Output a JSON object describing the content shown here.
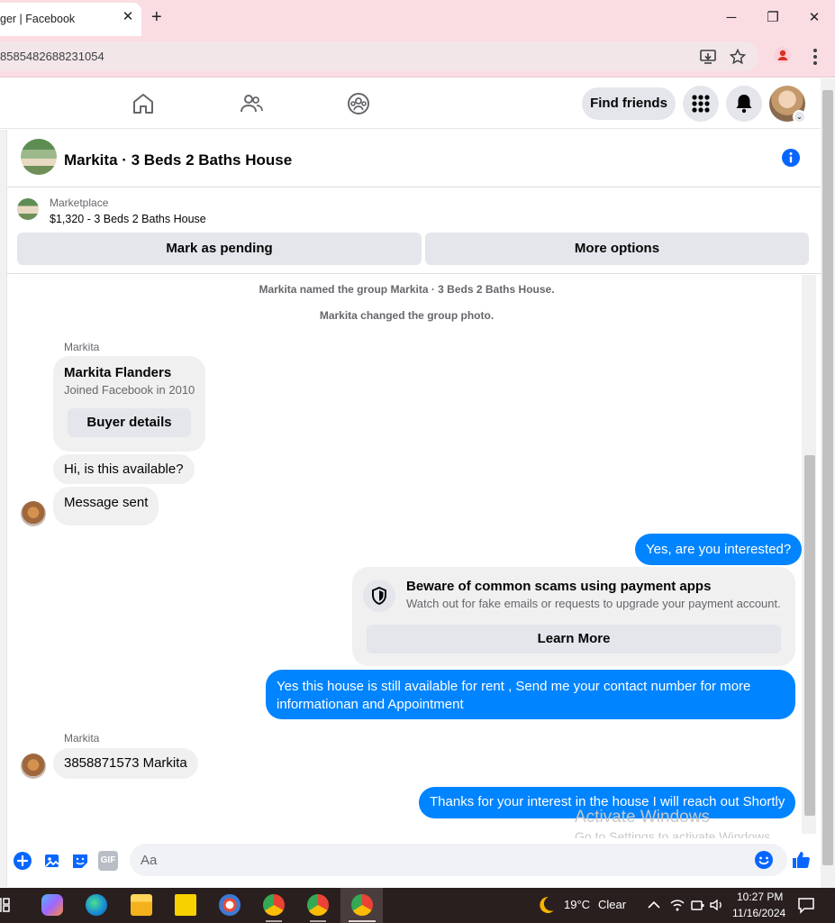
{
  "browser": {
    "tab_title": "ger | Facebook",
    "tab_close": "✕",
    "new_tab": "+",
    "minimize": "─",
    "restore": "❐",
    "close": "✕",
    "url": "8585482688231054"
  },
  "fb_nav": {
    "find_friends": "Find friends"
  },
  "chat": {
    "title": "Markita · 3 Beds 2 Baths House",
    "marketplace_label": "Marketplace",
    "listing": "$1,320 - 3 Beds 2 Baths House",
    "mark_pending": "Mark as pending",
    "more_options": "More options"
  },
  "messages": {
    "system1": "Markita named the group Markita · 3 Beds 2 Baths House.",
    "system2": "Markita changed the group photo.",
    "sender1": "Markita",
    "card_name": "Markita Flanders",
    "card_sub": "Joined Facebook in 2010",
    "card_button": "Buyer details",
    "in1": "Hi, is this available?",
    "in2": "Message sent",
    "out1": "Yes, are you interested?",
    "warning_title": "Beware of common scams using payment apps",
    "warning_sub": "Watch out for fake emails or requests to upgrade your payment account.",
    "warning_button": "Learn More",
    "out2": "Yes this house is still available for rent , Send me your contact number for more informationan and Appointment",
    "sender2": "Markita",
    "in3": "3858871573 Markita",
    "out3": "Thanks for your interest in the house I will reach out Shortly"
  },
  "watermark": {
    "line1": "Activate Windows",
    "line2": "Go to Settings to activate Windows."
  },
  "composer": {
    "placeholder": "Aa",
    "gif": "GIF"
  },
  "taskbar": {
    "temperature": "19°C",
    "weather": "Clear",
    "time": "10:27 PM",
    "date": "11/16/2024"
  },
  "colors": {
    "messenger_blue": "#0084ff",
    "chrome_pink": "#fadde2",
    "fb_gray": "#e4e6eb"
  }
}
